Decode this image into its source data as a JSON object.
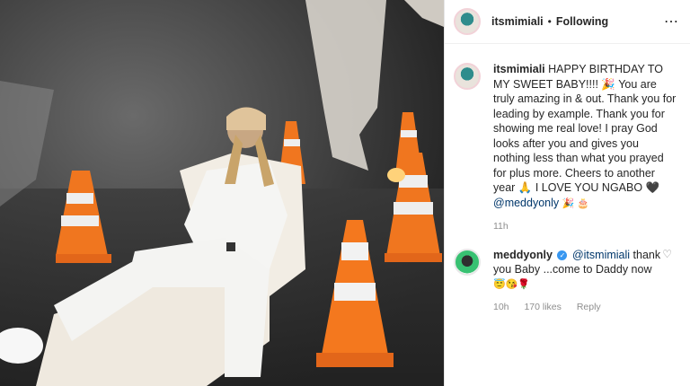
{
  "post": {
    "username": "itsmimiali",
    "separator": "•",
    "follow_state": "Following",
    "more_icon": "⋯"
  },
  "caption": {
    "username": "itsmimiali",
    "text": "HAPPY BIRTHDAY TO MY SWEET BABY!!!! 🎉 You are truly amazing in & out. Thank you for leading by example. Thank you for showing me real love! I pray God looks after you and gives you nothing less than what you prayed for plus more. Cheers to another year 🙏 I LOVE YOU NGABO 🖤",
    "mention": "@meddyonly",
    "trailing_emoji": "🎉 🎂",
    "time": "11h"
  },
  "reply": {
    "username": "meddyonly",
    "verified_mark": "✓",
    "mention": "@itsmimiali",
    "text": "thank you Baby ...come to Daddy now",
    "emoji": "😇😘🌹",
    "time": "10h",
    "likes": "170 likes",
    "reply_label": "Reply",
    "heart_icon": "♡"
  },
  "colors": {
    "link": "#00376b",
    "muted": "#8e8e8e",
    "text": "#262626",
    "verified": "#3897f0"
  }
}
